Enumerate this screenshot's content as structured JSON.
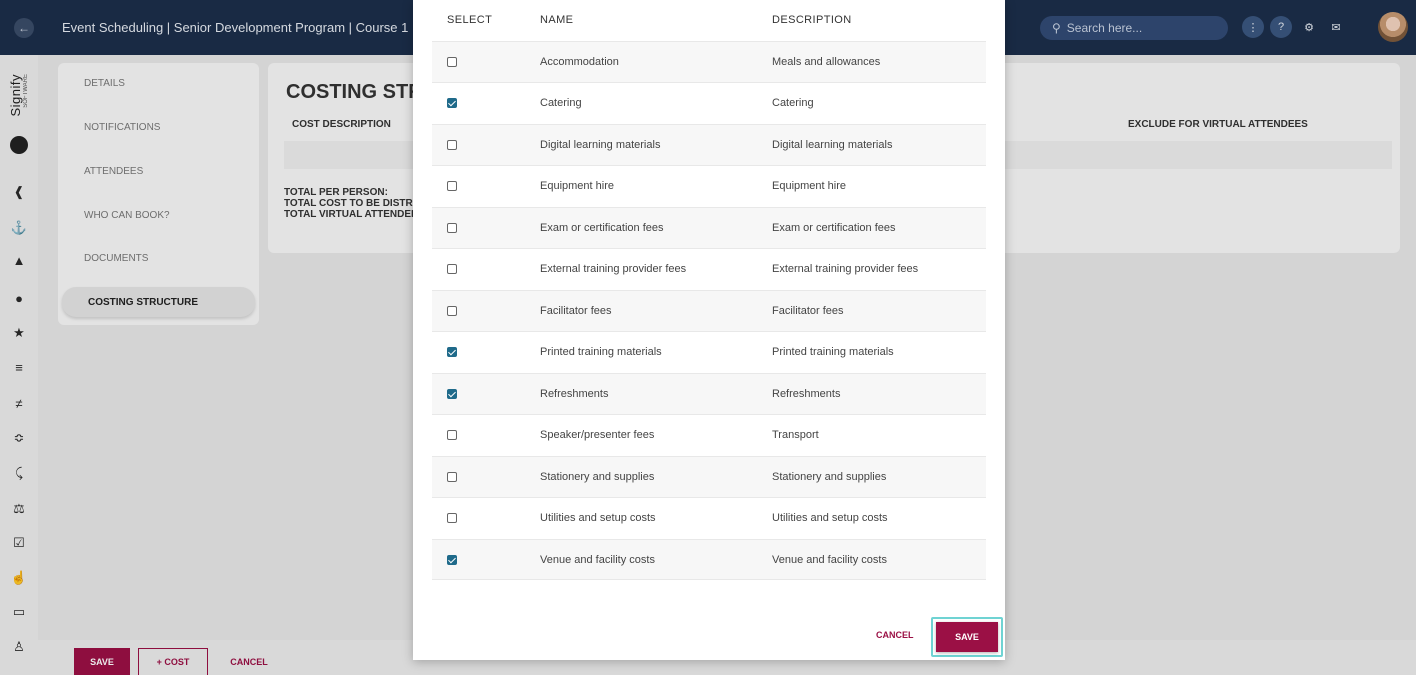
{
  "header": {
    "back_icon": "arrow-left-icon",
    "title": "Event Scheduling | Senior Development Program | Course 1",
    "search_placeholder": "Search here...",
    "icons": [
      "more-vertical-icon",
      "help-icon",
      "gear-icon",
      "mail-icon",
      "avatar"
    ]
  },
  "sidebar": {
    "logo_text": "Signify",
    "logo_sub": "SOFTWARE",
    "icons": [
      "megaphone-icon",
      "anchor-icon",
      "graduation-cap-icon",
      "compass-icon",
      "star-icon",
      "sliders-icon",
      "equalizer-icon",
      "handshake-icon",
      "user-run-icon",
      "scales-icon",
      "checkbox-icon",
      "thumbs-up-icon",
      "laptop-icon",
      "user-plus-icon"
    ]
  },
  "tabs": [
    {
      "label": "DETAILS"
    },
    {
      "label": "NOTIFICATIONS"
    },
    {
      "label": "ATTENDEES"
    },
    {
      "label": "WHO CAN BOOK?"
    },
    {
      "label": "DOCUMENTS"
    },
    {
      "label": "COSTING STRUCTURE",
      "active": true
    }
  ],
  "costing": {
    "title": "COSTING STRUCTURE",
    "cost_description_header": "COST DESCRIPTION",
    "exclude_header": "EXCLUDE FOR VIRTUAL ATTENDEES",
    "total_per_person": "TOTAL PER PERSON:",
    "total_distributed": "TOTAL COST TO BE DISTRIBUTED:",
    "total_virtual": "TOTAL VIRTUAL ATTENDEES:"
  },
  "footer": {
    "save_label": "SAVE",
    "add_cost_label": "+ COST",
    "cancel_label": "CANCEL"
  },
  "modal": {
    "headers": {
      "select": "SELECT",
      "name": "NAME",
      "description": "DESCRIPTION"
    },
    "rows": [
      {
        "name": "Accommodation",
        "description": "Meals and allowances",
        "checked": false
      },
      {
        "name": "Catering",
        "description": "Catering",
        "checked": true
      },
      {
        "name": "Digital learning materials",
        "description": "Digital learning materials",
        "checked": false
      },
      {
        "name": "Equipment hire",
        "description": "Equipment hire",
        "checked": false
      },
      {
        "name": "Exam or certification fees",
        "description": "Exam or certification fees",
        "checked": false
      },
      {
        "name": "External training provider fees",
        "description": "External training provider fees",
        "checked": false
      },
      {
        "name": "Facilitator fees",
        "description": "Facilitator fees",
        "checked": false
      },
      {
        "name": "Printed training materials",
        "description": "Printed training materials",
        "checked": true
      },
      {
        "name": "Refreshments",
        "description": "Refreshments",
        "checked": true
      },
      {
        "name": "Speaker/presenter fees",
        "description": "Transport",
        "checked": false
      },
      {
        "name": "Stationery and supplies",
        "description": "Stationery and supplies",
        "checked": false
      },
      {
        "name": "Utilities and setup costs",
        "description": "Utilities and setup costs",
        "checked": false
      },
      {
        "name": "Venue and facility costs",
        "description": "Venue and facility costs",
        "checked": true
      }
    ],
    "cancel_label": "CANCEL",
    "save_label": "SAVE"
  },
  "colors": {
    "topbar": "#1c2e4a",
    "accent": "#9b1045",
    "checkbox": "#1f6a8a",
    "focus_ring": "#6fd3d3"
  }
}
